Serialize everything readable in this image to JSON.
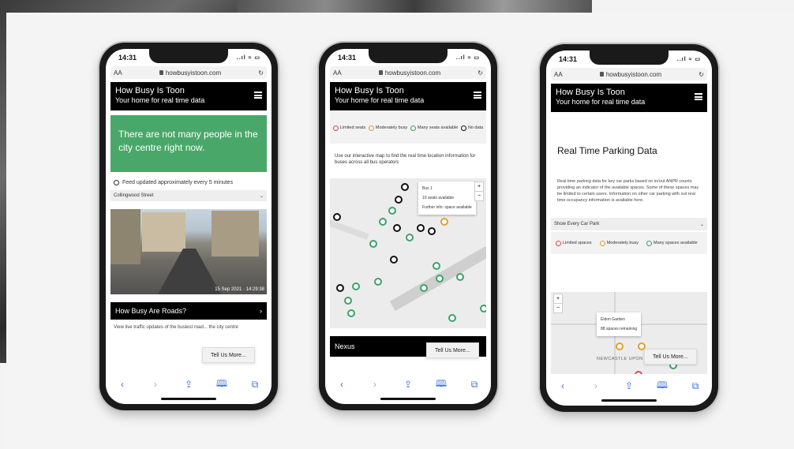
{
  "status": {
    "time": "14:31",
    "icons": "..ıl ≈ ▭"
  },
  "browser": {
    "text_size": "AA",
    "url": "howbusyistoon.com",
    "reload": "↻"
  },
  "header": {
    "title": "How Busy Is Toon",
    "subtitle": "Your home for real time data"
  },
  "icons": {
    "back": "chevron-left-icon",
    "forward": "chevron-right-icon",
    "share": "share-icon",
    "bookmarks": "book-icon",
    "tabs": "tabs-icon",
    "menu": "hamburger-icon"
  },
  "browser_glyphs": {
    "back": "‹",
    "forward": "›",
    "share": "⇪",
    "bookmarks": "🕮",
    "tabs": "⧉"
  },
  "phone1": {
    "alert": "There are not many people in the city centre right now.",
    "feed": "Feed updated approximately every 5 minutes",
    "camera_select": "Collingwood Street",
    "camera_timestamp": "15 Sep 2021 · 14:29:38",
    "section_title": "How Busy Are Roads?",
    "section_arrow": "›",
    "section_text": "View live traffic updates of the busiest road... the city centre",
    "tell_us": "Tell Us More..."
  },
  "phone2": {
    "legend": [
      {
        "label": "Limited seats",
        "color": "#d94a4a"
      },
      {
        "label": "Moderately busy",
        "color": "#e0a030"
      },
      {
        "label": "Many seats available",
        "color": "#3aa36a"
      },
      {
        "label": "No data",
        "color": "#111111"
      }
    ],
    "info": "Use our interactive map to find the real time location information for buses across all bus operators",
    "popup": {
      "line1": "Bus 1",
      "line2": "10 seats available",
      "line3": "Further info: space available"
    },
    "zoom_in": "+",
    "zoom_out": "−",
    "nexus": "Nexus",
    "tell_us": "Tell Us More..."
  },
  "phone3": {
    "title": "Real Time Parking Data",
    "text": "Real time parking data for key car parks based on in/out ANPR counts providing an indicator of the available spaces. Some of these spaces may be limited to certain users. Information on other car parking with out real time occupancy information is available here.",
    "select": "Show Every Car Park",
    "legend": [
      {
        "label": "Limited spaces",
        "color": "#d94a4a"
      },
      {
        "label": "Moderately busy",
        "color": "#e0a030"
      },
      {
        "label": "Many spaces available",
        "color": "#3aa36a"
      }
    ],
    "popup": {
      "line1": "Eldon Garden",
      "line2": "88 spaces remaining"
    },
    "map_label": "NEWCASTLE UPON",
    "zoom_in": "+",
    "zoom_out": "−",
    "tell_us": "Tell Us More..."
  }
}
